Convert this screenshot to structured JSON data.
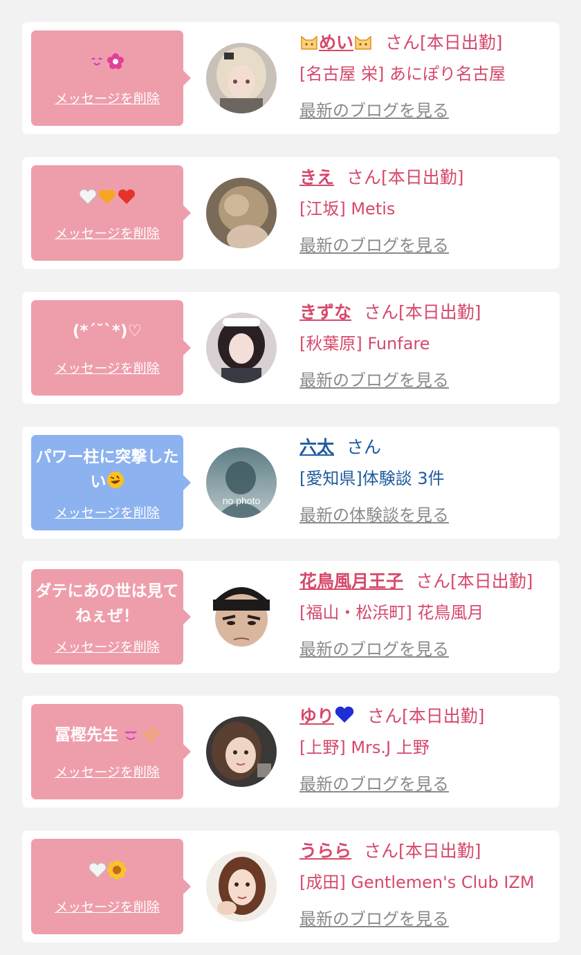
{
  "theme": {
    "pink_text": "#d6486a",
    "navy_text": "#1f5a9e",
    "bubble_pink": "#ee9eab",
    "bubble_blue": "#8db2f0"
  },
  "cards": [
    {
      "message": "",
      "message_icons": [
        "smile-emoji",
        "flower-emoji"
      ],
      "delete_label": "メッセージを削除",
      "name": "めい",
      "name_icons": [
        "cat-face-emoji",
        "cat-face-emoji"
      ],
      "suffix": "さん[本日出勤]",
      "shop": "[名古屋 栄] あにぽり名古屋",
      "link": "最新のブログを見る"
    },
    {
      "message": "",
      "message_icons": [
        "white-heart-emoji",
        "orange-heart-emoji",
        "red-heart-emoji"
      ],
      "delete_label": "メッセージを削除",
      "name": "きえ",
      "suffix": "さん[本日出勤]",
      "shop": "[江坂] Metis",
      "link": "最新のブログを見る"
    },
    {
      "message": "(*´˘`*)♡",
      "delete_label": "メッセージを削除",
      "name": "きずな",
      "suffix": "さん[本日出勤]",
      "shop": "[秋葉原] Funfare",
      "link": "最新のブログを見る"
    },
    {
      "message": "パワー柱に突撃したい",
      "message_icons": [
        "rolling-laughing-emoji"
      ],
      "delete_label": "メッセージを削除",
      "name": "六太",
      "suffix": "さん",
      "shop": "[愛知県]体験談 3件",
      "link": "最新の体験談を見る",
      "avatar_text": "no photo"
    },
    {
      "message": "ダテにあの世は見てねぇぜ！",
      "delete_label": "メッセージを削除",
      "name": "花鳥風月王子",
      "suffix": "さん[本日出勤]",
      "shop": "[福山・松浜町] 花鳥風月",
      "link": "最新のブログを見る"
    },
    {
      "message": "冨樫先生",
      "message_icons": [
        "heart-eyes-emoji",
        "sparkles-emoji"
      ],
      "delete_label": "メッセージを削除",
      "name": "ゆり",
      "name_icons": [
        "blue-heart-emoji"
      ],
      "suffix": "さん[本日出勤]",
      "shop": "[上野] Mrs.J 上野",
      "link": "最新のブログを見る"
    },
    {
      "message": "",
      "message_icons": [
        "white-heart-emoji",
        "sunflower-emoji"
      ],
      "delete_label": "メッセージを削除",
      "name": "うらら",
      "suffix": "さん[本日出勤]",
      "shop": "[成田] Gentlemen's Club IZM",
      "link": "最新のブログを見る"
    }
  ]
}
